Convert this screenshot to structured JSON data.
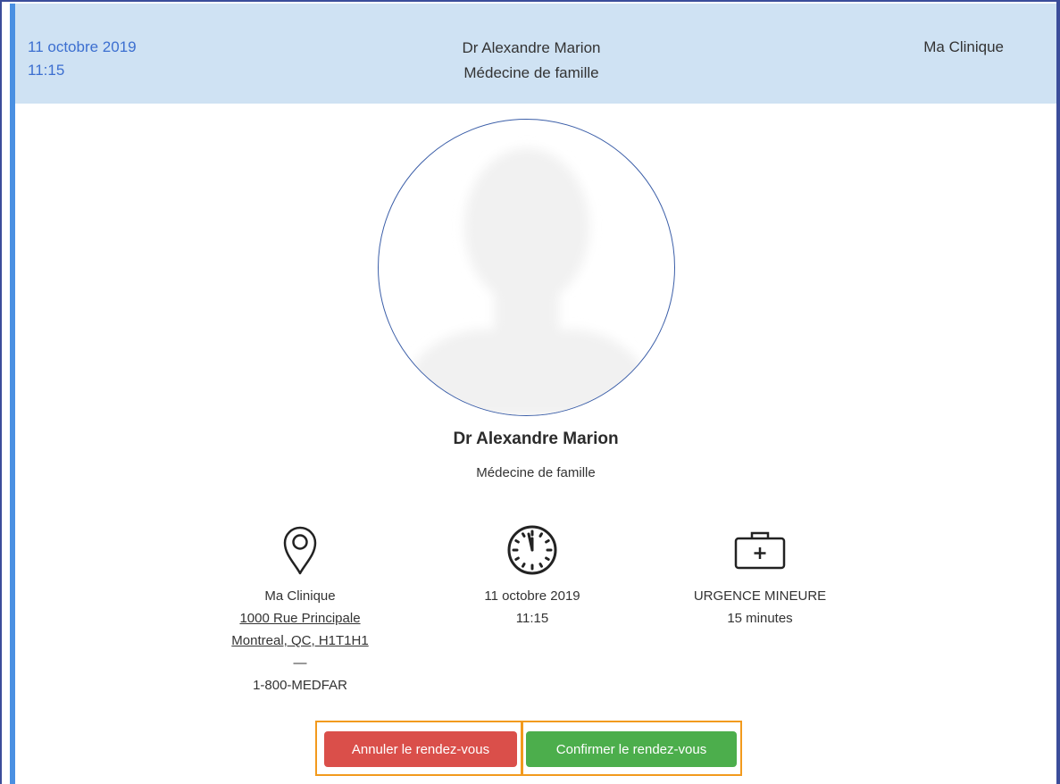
{
  "header": {
    "date": "11 octobre 2019",
    "time": "11:15",
    "doctor_name": "Dr Alexandre Marion",
    "specialty": "Médecine de famille",
    "clinic": "Ma Clinique"
  },
  "profile": {
    "avatar_icon": "user-silhouette-icon",
    "doctor_name": "Dr Alexandre Marion",
    "specialty": "Médecine de famille"
  },
  "details": {
    "location": {
      "icon": "map-pin-icon",
      "clinic": "Ma Clinique",
      "street": "1000 Rue Principale",
      "city": "Montreal, QC, H1T1H1",
      "separator": "—",
      "phone": "1-800-MEDFAR"
    },
    "time": {
      "icon": "clock-icon",
      "date": "11 octobre 2019",
      "time": "11:15"
    },
    "type": {
      "icon": "medical-kit-icon",
      "label": "URGENCE MINEURE",
      "duration": "15 minutes"
    }
  },
  "actions": {
    "cancel_label": "Annuler le rendez-vous",
    "confirm_label": "Confirmer le rendez-vous"
  },
  "colors": {
    "header_bg": "#cfe2f3",
    "date_accent": "#3c6fd0",
    "cancel": "#da4f4a",
    "confirm": "#4cae4c",
    "highlight": "#f29a1d"
  }
}
